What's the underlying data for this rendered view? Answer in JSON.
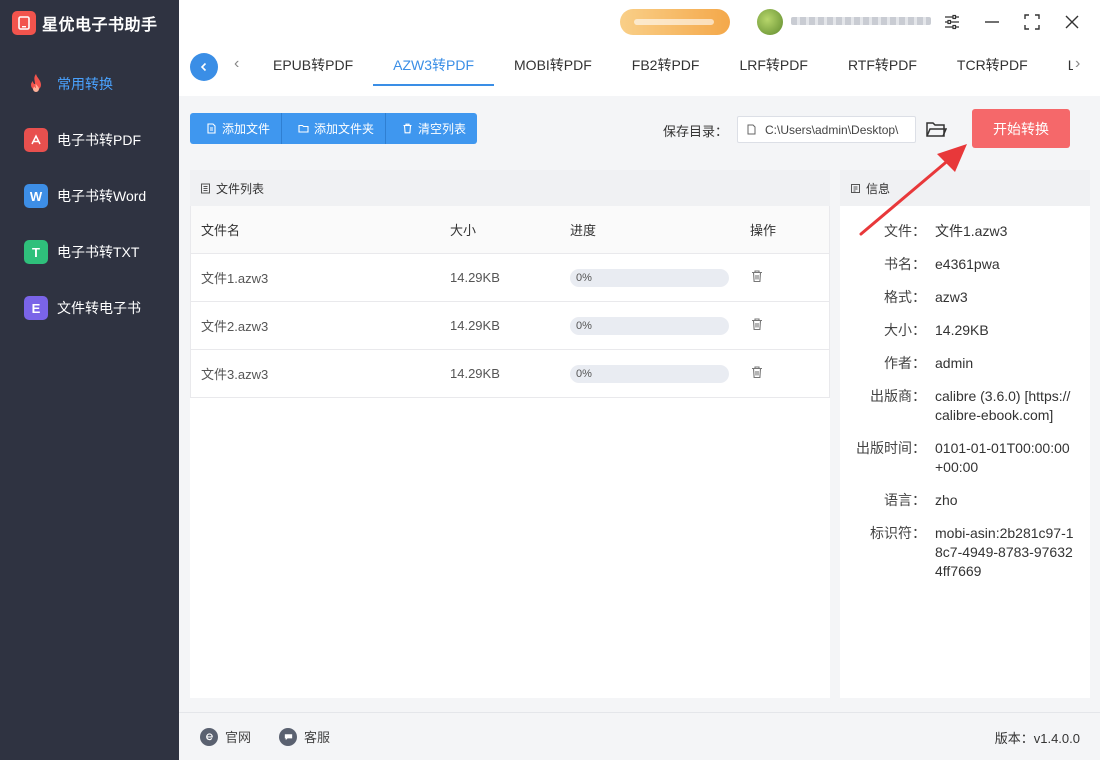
{
  "app": {
    "title": "星优电子书助手"
  },
  "sidebar": {
    "items": [
      {
        "label": "常用转换",
        "icon": "fire-icon",
        "active": true
      },
      {
        "label": "电子书转PDF",
        "icon": "pdf-icon",
        "glyph": "⅄",
        "color": "#e8504e"
      },
      {
        "label": "电子书转Word",
        "icon": "word-icon",
        "glyph": "W",
        "color": "#3d8ee6"
      },
      {
        "label": "电子书转TXT",
        "icon": "txt-icon",
        "glyph": "T",
        "color": "#2fc07b"
      },
      {
        "label": "文件转电子书",
        "icon": "ebook-icon",
        "glyph": "E",
        "color": "#7a64e8"
      }
    ]
  },
  "tabs": [
    {
      "label": "EPUB转PDF"
    },
    {
      "label": "AZW3转PDF",
      "active": true
    },
    {
      "label": "MOBI转PDF"
    },
    {
      "label": "FB2转PDF"
    },
    {
      "label": "LRF转PDF"
    },
    {
      "label": "RTF转PDF"
    },
    {
      "label": "TCR转PDF"
    },
    {
      "label": "LIT转"
    }
  ],
  "toolbar": {
    "add_file": "添加文件",
    "add_folder": "添加文件夹",
    "clear_list": "清空列表",
    "save_label": "保存目录：",
    "save_path": "C:\\Users\\admin\\Desktop\\",
    "start": "开始转换"
  },
  "file_list": {
    "title": "文件列表",
    "columns": {
      "name": "文件名",
      "size": "大小",
      "progress": "进度",
      "action": "操作"
    },
    "rows": [
      {
        "name": "文件1.azw3",
        "size": "14.29KB",
        "progress_text": "0%",
        "progress": 0
      },
      {
        "name": "文件2.azw3",
        "size": "14.29KB",
        "progress_text": "0%",
        "progress": 0
      },
      {
        "name": "文件3.azw3",
        "size": "14.29KB",
        "progress_text": "0%",
        "progress": 0
      }
    ]
  },
  "info": {
    "title": "信息",
    "rows": [
      {
        "key": "文件：",
        "value": "文件1.azw3"
      },
      {
        "key": "书名：",
        "value": "e4361pwa"
      },
      {
        "key": "格式：",
        "value": "azw3"
      },
      {
        "key": "大小：",
        "value": "14.29KB"
      },
      {
        "key": "作者：",
        "value": "admin"
      },
      {
        "key": "出版商：",
        "value": "calibre (3.6.0) [https://calibre-ebook.com]"
      },
      {
        "key": "出版时间：",
        "value": "0101-01-01T00:00:00+00:00"
      },
      {
        "key": "语言：",
        "value": "zho"
      },
      {
        "key": "标识符：",
        "value": "mobi-asin:2b281c97-18c7-4949-8783-976324ff7669"
      }
    ]
  },
  "footer": {
    "website": "官网",
    "support": "客服",
    "version": "版本：v1.4.0.0"
  },
  "colors": {
    "accent": "#3a8ee6",
    "start_button": "#f5686a",
    "sidebar_bg": "#2f3341",
    "annotation": "#e8383a"
  }
}
